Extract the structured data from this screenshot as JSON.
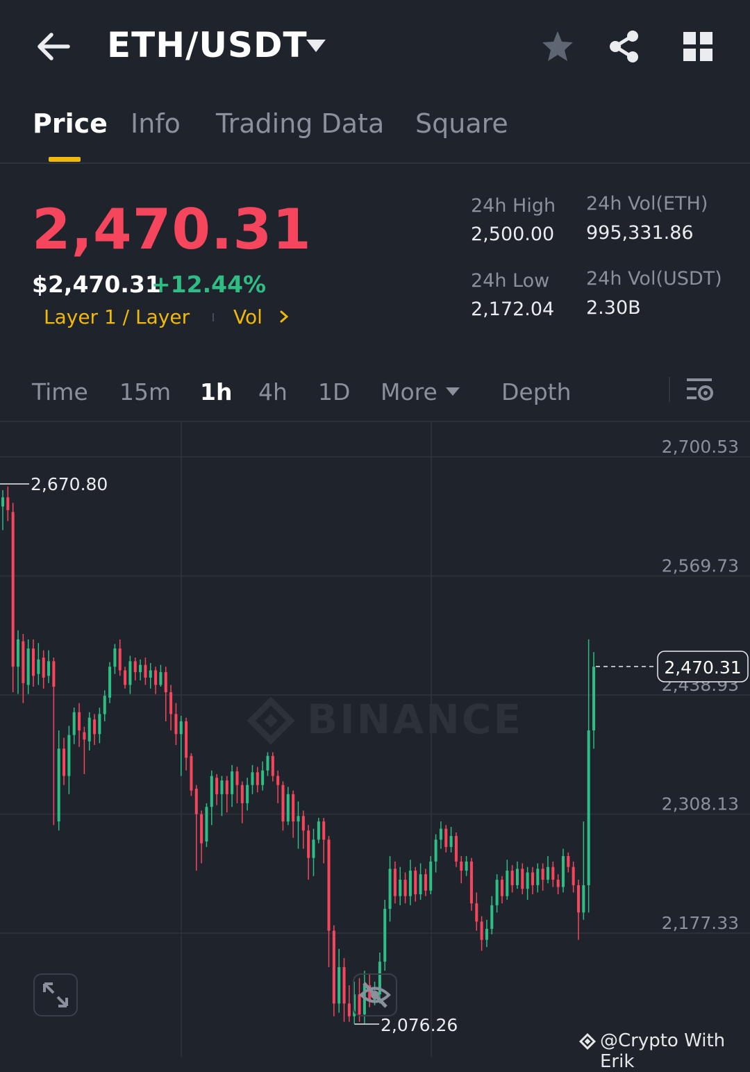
{
  "header": {
    "pair": "ETH/USDT",
    "icons": [
      "back-arrow-icon",
      "caret-down-icon",
      "star-icon",
      "share-icon",
      "grid-icon"
    ]
  },
  "tabs": [
    {
      "label": "Price",
      "active": true
    },
    {
      "label": "Info"
    },
    {
      "label": "Trading Data"
    },
    {
      "label": "Square"
    }
  ],
  "ticker": {
    "last_price": "2,470.31",
    "usd_price": "$2,470.31",
    "change_pct": "+12.44%",
    "category": "Layer 1 / Layer",
    "vol_link": "Vol",
    "stats": {
      "high_label": "24h High",
      "high_value": "2,500.00",
      "low_label": "24h Low",
      "low_value": "2,172.04",
      "vol_eth_label": "24h Vol(ETH)",
      "vol_eth_value": "995,331.86",
      "vol_usdt_label": "24h Vol(USDT)",
      "vol_usdt_value": "2.30B"
    }
  },
  "intervals": {
    "time": "Time",
    "m15": "15m",
    "h1": "1h",
    "h4": "4h",
    "d1": "1D",
    "more": "More",
    "depth": "Depth",
    "active": "1h"
  },
  "colors": {
    "up": "#2ebd85",
    "down": "#f6465d",
    "accent": "#f0b90b",
    "bg": "#1f232b"
  },
  "chart_data": {
    "type": "candlestick",
    "y_ticks": [
      "2,700.53",
      "2,569.73",
      "2,438.93",
      "2,308.13",
      "2,177.33"
    ],
    "y_tick_values": [
      2700.53,
      2569.73,
      2438.93,
      2308.13,
      2177.33
    ],
    "high_marker": "2,670.80",
    "low_marker": "2,076.26",
    "current_price_label": "2,470.31",
    "current_price": 2470.31,
    "watermark": "BINANCE",
    "grid": true,
    "candles": [
      [
        2646,
        2656,
        2664,
        2620
      ],
      [
        2656,
        2642,
        2668,
        2630
      ],
      [
        2640,
        2470,
        2650,
        2442
      ],
      [
        2470,
        2500,
        2510,
        2440
      ],
      [
        2498,
        2452,
        2506,
        2430
      ],
      [
        2450,
        2490,
        2500,
        2440
      ],
      [
        2490,
        2460,
        2500,
        2448
      ],
      [
        2462,
        2478,
        2496,
        2450
      ],
      [
        2480,
        2458,
        2488,
        2446
      ],
      [
        2460,
        2476,
        2488,
        2452
      ],
      [
        2476,
        2448,
        2480,
        2296
      ],
      [
        2300,
        2380,
        2400,
        2290
      ],
      [
        2380,
        2350,
        2392,
        2340
      ],
      [
        2350,
        2395,
        2405,
        2330
      ],
      [
        2395,
        2420,
        2425,
        2385
      ],
      [
        2420,
        2400,
        2430,
        2382
      ],
      [
        2398,
        2390,
        2404,
        2352
      ],
      [
        2388,
        2414,
        2420,
        2378
      ],
      [
        2412,
        2396,
        2418,
        2384
      ],
      [
        2396,
        2418,
        2425,
        2386
      ],
      [
        2418,
        2438,
        2444,
        2410
      ],
      [
        2436,
        2470,
        2475,
        2430
      ],
      [
        2470,
        2490,
        2495,
        2462
      ],
      [
        2490,
        2466,
        2500,
        2460
      ],
      [
        2466,
        2450,
        2470,
        2446
      ],
      [
        2450,
        2476,
        2482,
        2440
      ],
      [
        2476,
        2464,
        2480,
        2455
      ],
      [
        2464,
        2472,
        2478,
        2455
      ],
      [
        2472,
        2458,
        2480,
        2450
      ],
      [
        2458,
        2466,
        2474,
        2446
      ],
      [
        2466,
        2450,
        2470,
        2440
      ],
      [
        2450,
        2464,
        2472,
        2448
      ],
      [
        2464,
        2442,
        2470,
        2410
      ],
      [
        2442,
        2418,
        2450,
        2400
      ],
      [
        2418,
        2396,
        2430,
        2384
      ],
      [
        2396,
        2410,
        2416,
        2350
      ],
      [
        2410,
        2370,
        2414,
        2356
      ],
      [
        2372,
        2334,
        2375,
        2328
      ],
      [
        2336,
        2308,
        2340,
        2246
      ],
      [
        2308,
        2276,
        2312,
        2254
      ],
      [
        2278,
        2316,
        2320,
        2272
      ],
      [
        2316,
        2350,
        2356,
        2296
      ],
      [
        2348,
        2330,
        2352,
        2318
      ],
      [
        2330,
        2345,
        2350,
        2306
      ],
      [
        2345,
        2330,
        2350,
        2310
      ],
      [
        2330,
        2355,
        2362,
        2316
      ],
      [
        2355,
        2340,
        2360,
        2320
      ],
      [
        2340,
        2320,
        2344,
        2298
      ],
      [
        2320,
        2340,
        2348,
        2312
      ],
      [
        2340,
        2354,
        2362,
        2330
      ],
      [
        2354,
        2340,
        2360,
        2332
      ],
      [
        2340,
        2356,
        2366,
        2334
      ],
      [
        2356,
        2372,
        2376,
        2350
      ],
      [
        2372,
        2350,
        2376,
        2344
      ],
      [
        2350,
        2340,
        2356,
        2320
      ],
      [
        2340,
        2300,
        2344,
        2290
      ],
      [
        2300,
        2330,
        2338,
        2296
      ],
      [
        2330,
        2300,
        2334,
        2282
      ],
      [
        2300,
        2306,
        2322,
        2270
      ],
      [
        2306,
        2290,
        2312,
        2270
      ],
      [
        2290,
        2260,
        2296,
        2236
      ],
      [
        2260,
        2280,
        2292,
        2240
      ],
      [
        2280,
        2300,
        2304,
        2276
      ],
      [
        2300,
        2280,
        2304,
        2254
      ],
      [
        2280,
        2180,
        2284,
        2140
      ],
      [
        2180,
        2100,
        2186,
        2086
      ],
      [
        2100,
        2140,
        2160,
        2090
      ],
      [
        2140,
        2100,
        2150,
        2080
      ],
      [
        2100,
        2086,
        2120,
        2080
      ],
      [
        2086,
        2110,
        2124,
        2078
      ],
      [
        2110,
        2088,
        2128,
        2080
      ],
      [
        2088,
        2120,
        2136,
        2078
      ],
      [
        2120,
        2104,
        2132,
        2096
      ],
      [
        2104,
        2110,
        2124,
        2098
      ],
      [
        2110,
        2146,
        2156,
        2100
      ],
      [
        2146,
        2204,
        2214,
        2136
      ],
      [
        2204,
        2248,
        2262,
        2190
      ],
      [
        2248,
        2218,
        2256,
        2210
      ],
      [
        2218,
        2236,
        2250,
        2208
      ],
      [
        2236,
        2218,
        2244,
        2210
      ],
      [
        2218,
        2246,
        2258,
        2208
      ],
      [
        2246,
        2220,
        2250,
        2212
      ],
      [
        2220,
        2242,
        2254,
        2214
      ],
      [
        2242,
        2224,
        2248,
        2218
      ],
      [
        2224,
        2256,
        2262,
        2220
      ],
      [
        2256,
        2280,
        2286,
        2244
      ],
      [
        2280,
        2292,
        2300,
        2270
      ],
      [
        2292,
        2272,
        2296,
        2266
      ],
      [
        2272,
        2284,
        2294,
        2266
      ],
      [
        2284,
        2256,
        2288,
        2250
      ],
      [
        2256,
        2246,
        2262,
        2232
      ],
      [
        2246,
        2256,
        2262,
        2240
      ],
      [
        2256,
        2210,
        2260,
        2202
      ],
      [
        2210,
        2190,
        2222,
        2180
      ],
      [
        2190,
        2170,
        2196,
        2158
      ],
      [
        2170,
        2182,
        2192,
        2162
      ],
      [
        2182,
        2208,
        2218,
        2176
      ],
      [
        2208,
        2236,
        2242,
        2200
      ],
      [
        2236,
        2218,
        2240,
        2210
      ],
      [
        2218,
        2246,
        2258,
        2214
      ],
      [
        2246,
        2230,
        2252,
        2222
      ],
      [
        2230,
        2248,
        2256,
        2226
      ],
      [
        2248,
        2226,
        2254,
        2220
      ],
      [
        2226,
        2244,
        2250,
        2214
      ],
      [
        2244,
        2230,
        2250,
        2220
      ],
      [
        2230,
        2248,
        2254,
        2222
      ],
      [
        2248,
        2236,
        2254,
        2224
      ],
      [
        2236,
        2250,
        2262,
        2232
      ],
      [
        2250,
        2236,
        2256,
        2228
      ],
      [
        2236,
        2228,
        2242,
        2220
      ],
      [
        2228,
        2262,
        2270,
        2222
      ],
      [
        2262,
        2250,
        2266,
        2244
      ],
      [
        2250,
        2230,
        2256,
        2222
      ],
      [
        2230,
        2200,
        2236,
        2170
      ],
      [
        2200,
        2230,
        2300,
        2192
      ],
      [
        2230,
        2400,
        2500,
        2200
      ],
      [
        2400,
        2470,
        2486,
        2380
      ]
    ]
  },
  "credit": "@Crypto With Erik"
}
